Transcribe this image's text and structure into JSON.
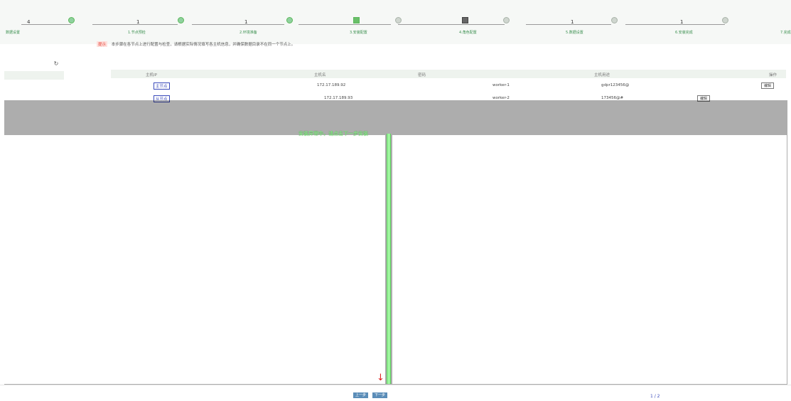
{
  "steps": {
    "numbers": [
      "4",
      "1",
      "1",
      "1",
      "1"
    ],
    "labels": [
      "数据设置",
      "1.节点预检",
      "2.环境准备",
      "3.安装配置",
      "4.角色配置",
      "5.数据设置",
      "6.安装完成",
      "7.完成"
    ]
  },
  "notice": {
    "tag": "提示",
    "text": "本步骤在各节点上进行配置与检查，请根据实际情况填写各主机信息，并确保数据目录不在同一个节点上。"
  },
  "table": {
    "headers": [
      "主机IP",
      "主机名",
      "密码",
      "主机用途",
      "操作"
    ],
    "rows": [
      {
        "ip_link": "主节点",
        "ip": "172.17.189.92",
        "host": "worker-1",
        "purpose": "gdpr123456@",
        "op": "编辑"
      },
      {
        "ip_link": "从节点",
        "ip": "172.17.189.93",
        "host": "worker-2",
        "purpose": "173456@#",
        "op": "编辑"
      }
    ]
  },
  "overlay": {
    "message": "安装异常中，请点击下一步安装"
  },
  "footer": {
    "prev": "上一步",
    "next": "下一步",
    "page": "1 / 2"
  },
  "icons": {
    "refresh": "refresh-icon",
    "arrow": "arrow-down-icon"
  },
  "colors": {
    "accent": "#5cb85c",
    "link": "#3b4bbb",
    "warn": "#e23b2e"
  }
}
